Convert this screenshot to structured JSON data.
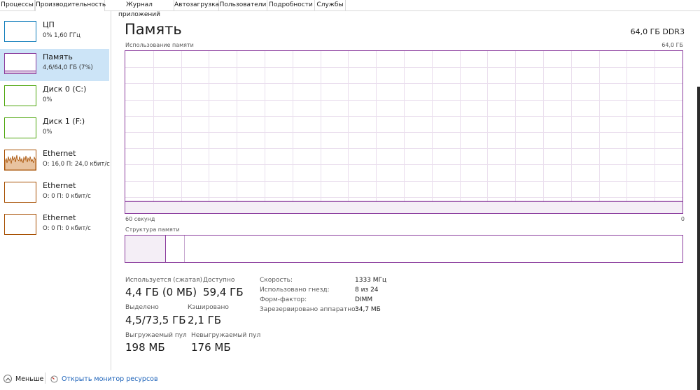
{
  "tabs": [
    {
      "label": "Процессы"
    },
    {
      "label": "Производительность"
    },
    {
      "label": "Журнал приложений"
    },
    {
      "label": "Автозагрузка"
    },
    {
      "label": "Пользователи"
    },
    {
      "label": "Подробности"
    },
    {
      "label": "Службы"
    }
  ],
  "active_tab": "Производительность",
  "sidebar": {
    "items": [
      {
        "title": "ЦП",
        "sub": "0% 1,60 ГГц",
        "color": "#117dbb"
      },
      {
        "title": "Память",
        "sub": "4,6/64,0 ГБ (7%)",
        "color": "#8b12ae"
      },
      {
        "title": "Диск 0 (C:)",
        "sub": "0%",
        "color": "#4da60c"
      },
      {
        "title": "Диск 1 (F:)",
        "sub": "0%",
        "color": "#4da60c"
      },
      {
        "title": "Ethernet",
        "sub": "О: 16,0 П: 24,0 кбит/с",
        "color": "#a74f01"
      },
      {
        "title": "Ethernet",
        "sub": "О: 0 П: 0 кбит/с",
        "color": "#a74f01"
      },
      {
        "title": "Ethernet",
        "sub": "О: 0 П: 0 кбит/с",
        "color": "#a74f01"
      }
    ],
    "selected_index": 1
  },
  "main": {
    "title": "Память",
    "capacity": "64,0 ГБ DDR3",
    "graph_label": "Использование памяти",
    "graph_max": "64,0 ГБ",
    "time_left": "60 секунд",
    "time_right": "0",
    "usage_fraction": 0.072,
    "structure_label": "Структура памяти",
    "structure_used_fraction": 0.072,
    "structure_modified_fraction": 0.033
  },
  "stats": {
    "in_use_label": "Используется (сжатая)",
    "in_use_value": "4,4 ГБ (0 МБ)",
    "available_label": "Доступно",
    "available_value": "59,4 ГБ",
    "committed_label": "Выделено",
    "committed_value": "4,5/73,5 ГБ",
    "cached_label": "Кэшировано",
    "cached_value": "2,1 ГБ",
    "paged_label": "Выгружаемый пул",
    "paged_value": "198 МБ",
    "nonpaged_label": "Невыгружаемый пул",
    "nonpaged_value": "176 МБ"
  },
  "details": [
    {
      "label": "Скорость:",
      "value": "1333 МГц"
    },
    {
      "label": "Использовано гнезд:",
      "value": "8 из 24"
    },
    {
      "label": "Форм-фактор:",
      "value": "DIMM"
    },
    {
      "label": "Зарезервировано аппаратно:",
      "value": "34,7 МБ"
    }
  ],
  "footer": {
    "less_label": "Меньше",
    "monitor_label": "Открыть монитор ресурсов"
  },
  "colors": {
    "memory": "#8b3d9e",
    "memory_fill": "#f4eef6",
    "link": "#1c62b9",
    "selected_bg": "#cce4f7"
  },
  "icons": {
    "less": "chevron-up-icon",
    "monitor": "resource-monitor-icon"
  }
}
